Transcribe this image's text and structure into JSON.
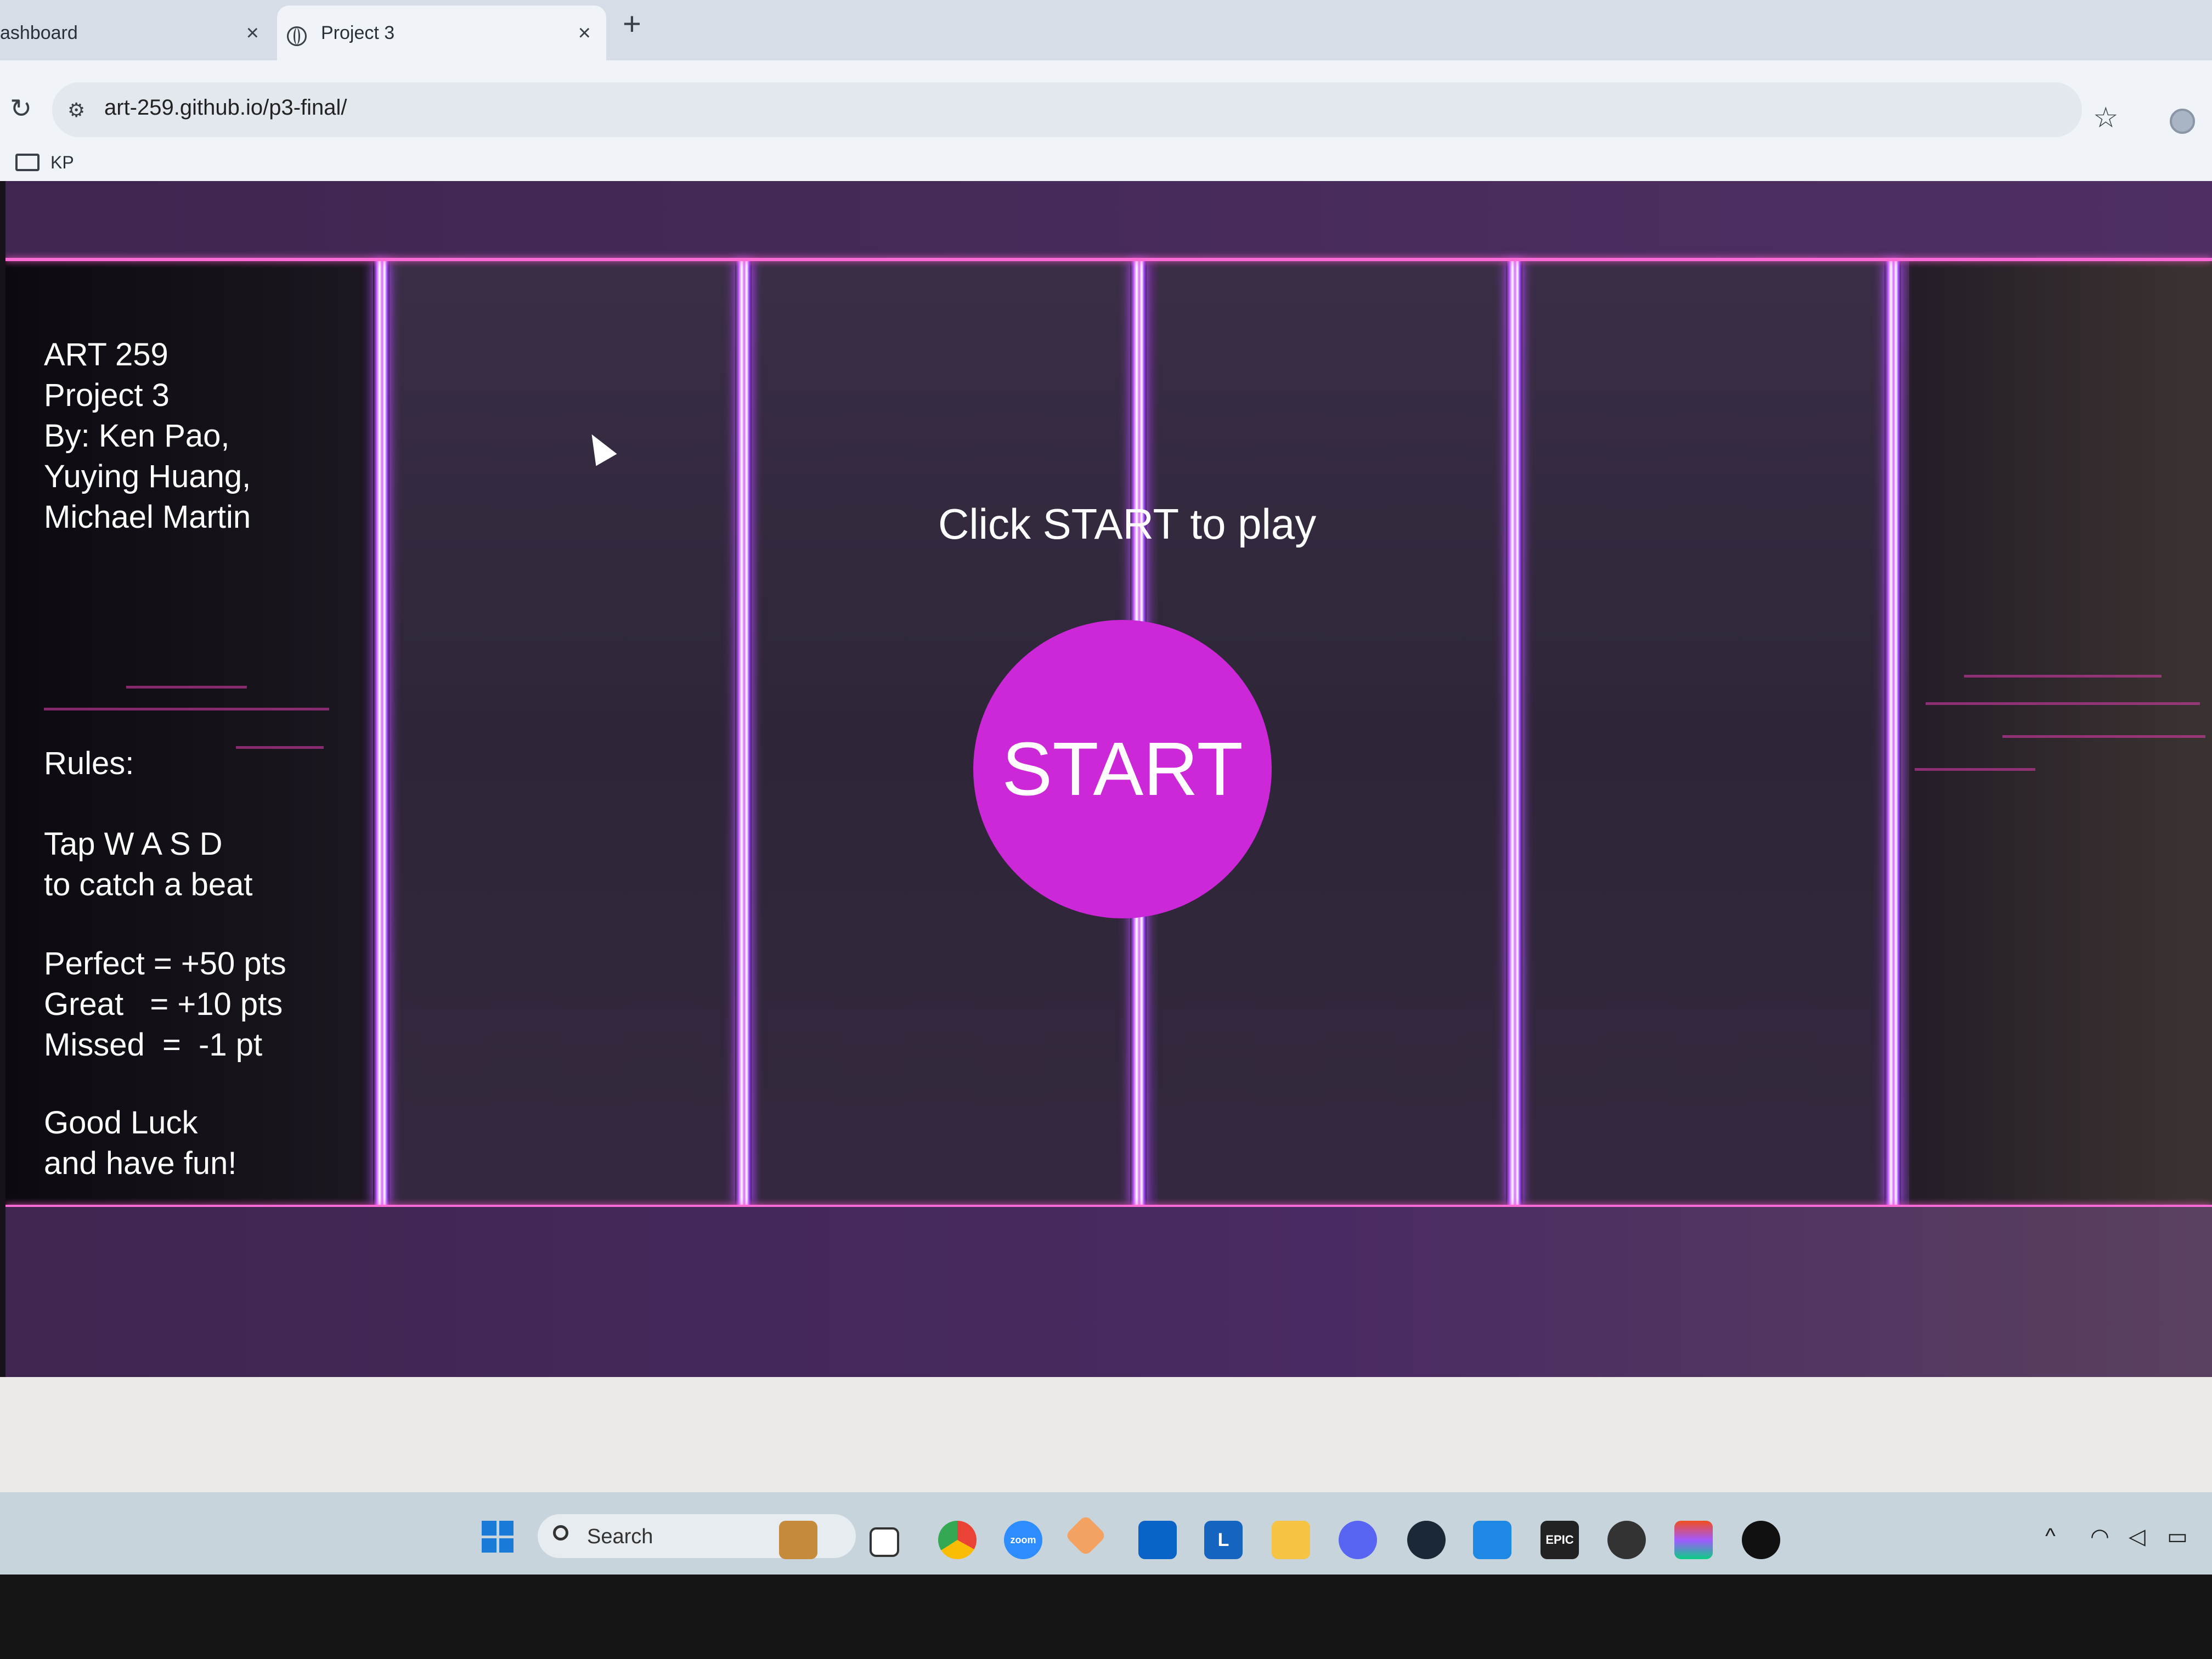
{
  "browser": {
    "tabs": [
      {
        "title": "ashboard",
        "close": "×"
      },
      {
        "title": "Project 3",
        "close": "×"
      }
    ],
    "new_tab": "+",
    "reload_icon": "↻",
    "site_info_icon": "site-info-icon",
    "url": "art-259.github.io/p3-final/",
    "star_icon": "☆",
    "bookmarks": [
      {
        "label": "KP"
      }
    ]
  },
  "game": {
    "info": "ART 259\nProject 3\nBy: Ken Pao,\nYuying Huang,\nMichael Martin",
    "rules_title": "Rules:",
    "rules_controls": "Tap W A S D\nto catch a beat",
    "scores": "Perfect = +50 pts\nGreat   = +10 pts\nMissed  =  -1 pt",
    "closing": "Good Luck\nand have fun!",
    "prompt": "Click START to play",
    "start_label": "START",
    "colors": {
      "start_button": "#cc28d8",
      "lane_line": "#b84dff",
      "border_line": "#ff6bd6"
    }
  },
  "taskbar": {
    "search_label": "Search",
    "apps": [
      "chrome-icon",
      "zoom-icon",
      "git-icon",
      "outlook-icon",
      "l-app-icon",
      "file-explorer-icon",
      "discord-icon",
      "steam-icon",
      "vscode-icon",
      "epic-games-icon",
      "github-icon",
      "figma-icon",
      "unreal-icon"
    ],
    "zoom_label": "zoom",
    "l_label": "L",
    "epic_label": "EPIC",
    "tray_up": "^"
  }
}
